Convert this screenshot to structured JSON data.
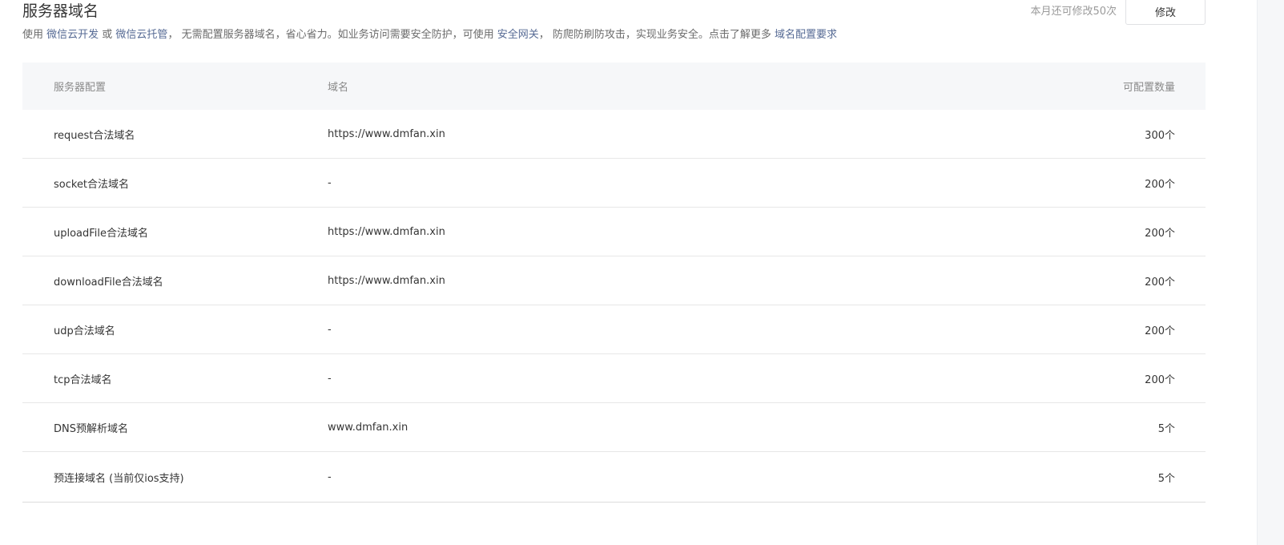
{
  "header": {
    "title": "服务器域名",
    "quota_text": "本月还可修改50次",
    "modify_label": "修改"
  },
  "description": {
    "prefix": "使用 ",
    "link1": "微信云开发",
    "or": " 或 ",
    "link2": "微信云托管",
    "middle": "， 无需配置服务器域名，省心省力。如业务访问需要安全防护，可使用 ",
    "link3": "安全网关",
    "suffix": "， 防爬防刷防攻击，实现业务安全。点击了解更多 ",
    "link4": "域名配置要求"
  },
  "table": {
    "headers": [
      "服务器配置",
      "域名",
      "可配置数量"
    ],
    "rows": [
      {
        "config": "request合法域名",
        "domain": "https://www.dmfan.xin",
        "count": "300个"
      },
      {
        "config": "socket合法域名",
        "domain": "-",
        "count": "200个"
      },
      {
        "config": "uploadFile合法域名",
        "domain": "https://www.dmfan.xin",
        "count": "200个"
      },
      {
        "config": "downloadFile合法域名",
        "domain": "https://www.dmfan.xin",
        "count": "200个"
      },
      {
        "config": "udp合法域名",
        "domain": "-",
        "count": "200个"
      },
      {
        "config": "tcp合法域名",
        "domain": "-",
        "count": "200个"
      },
      {
        "config": "DNS预解析域名",
        "domain": "www.dmfan.xin",
        "count": "5个"
      },
      {
        "config": "预连接域名 (当前仅ios支持)",
        "domain": "-",
        "count": "5个"
      }
    ]
  },
  "colors": {
    "link": "#576b95",
    "header_bg": "#f6f7f9",
    "text": "#353535",
    "muted": "#8a8a8a"
  }
}
